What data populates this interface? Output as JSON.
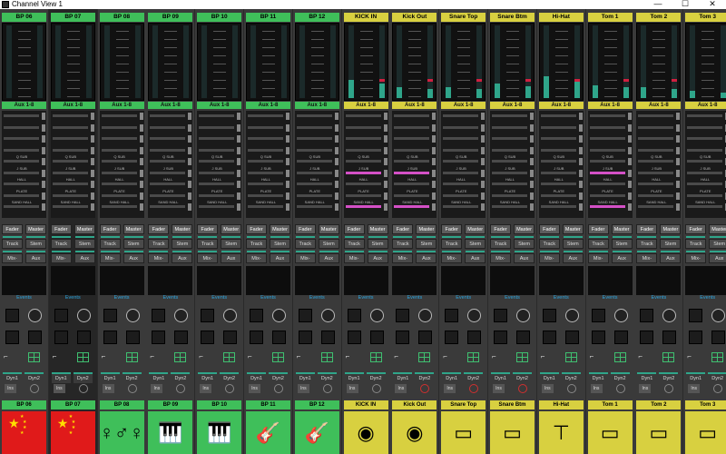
{
  "window": {
    "title": "Channel View 1",
    "minimize": "—",
    "maximize": "☐",
    "close": "✕"
  },
  "colors": {
    "green": "#3fbf5a",
    "yellow": "#d8d040",
    "accent": "#2fa58a",
    "pink": "#d450c6",
    "flagred": "#e01a1a"
  },
  "sends": [
    "Q SUB",
    "J SUB",
    "HALL",
    "PLATE",
    "SAND HALL"
  ],
  "buttons": {
    "fader": "Fader",
    "master": "Master",
    "track": "Track",
    "stem": "Stem",
    "mix": "Mix-",
    "aux": "Aux",
    "events": "Events",
    "dyn1": "Dyn1",
    "dyn2": "Dyn2",
    "ins": "Ins"
  },
  "strips": [
    {
      "name": "BP 06",
      "aux": "Aux 1-8",
      "footer": "BP 06",
      "color": "green",
      "art": "flag"
    },
    {
      "name": "BP 07",
      "aux": "Aux 1-8",
      "footer": "BP 07",
      "color": "green",
      "art": "flag"
    },
    {
      "name": "BP 08",
      "aux": "Aux 1-8",
      "footer": "BP 08",
      "color": "green",
      "art": "dancers-icon"
    },
    {
      "name": "BP 09",
      "aux": "Aux 1-8",
      "footer": "BP 09",
      "color": "green",
      "art": "keyboard-icon"
    },
    {
      "name": "BP 10",
      "aux": "Aux 1-8",
      "footer": "BP 10",
      "color": "green",
      "art": "grand-piano-icon"
    },
    {
      "name": "BP 11",
      "aux": "Aux 1-8",
      "footer": "BP 11",
      "color": "green",
      "art": "electric-guitar-icon"
    },
    {
      "name": "BP 12",
      "aux": "Aux 1-8",
      "footer": "BP 12",
      "color": "green",
      "art": "acoustic-guitar-icon"
    },
    {
      "name": "KICK  IN",
      "aux": "Aux 1-8",
      "footer": "KICK  IN",
      "color": "yellow",
      "art": "kick-drum-icon"
    },
    {
      "name": "Kick Out",
      "aux": "Aux 1-8",
      "footer": "Kick Out",
      "color": "yellow",
      "art": "kick-drum-mic-icon"
    },
    {
      "name": "Snare Top",
      "aux": "Aux 1-8",
      "footer": "Snare Top",
      "color": "yellow",
      "art": "snare-mic-icon"
    },
    {
      "name": "Snare Btm",
      "aux": "Aux 1-8",
      "footer": "Snare Btm",
      "color": "yellow",
      "art": "snare-drum-icon"
    },
    {
      "name": "Hi-Hat",
      "aux": "Aux 1-8",
      "footer": "Hi-Hat",
      "color": "yellow",
      "art": "hihat-icon"
    },
    {
      "name": "Tom 1",
      "aux": "Aux 1-8",
      "footer": "Tom 1",
      "color": "yellow",
      "art": "tom-drum-icon"
    },
    {
      "name": "Tom 2",
      "aux": "Aux 1-8",
      "footer": "Tom 2",
      "color": "yellow",
      "art": "tom-drum-icon"
    },
    {
      "name": "Tom 3",
      "aux": "Aux 1-8",
      "footer": "Tom 3",
      "color": "yellow",
      "art": "tom-drum-icon"
    }
  ]
}
